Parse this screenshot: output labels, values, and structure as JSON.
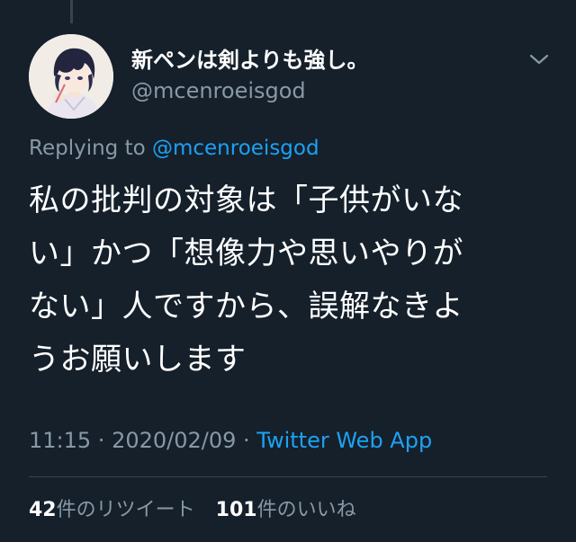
{
  "tweet": {
    "display_name": "新ペンは剣よりも強し。",
    "handle": "@mcenroeisgod",
    "replying_prefix": "Replying to ",
    "replying_to": "@mcenroeisgod",
    "text_lines": [
      "私の批判の対象は「子供がいな",
      "い」かつ「想像力や思いやりが",
      "ない」人ですから、誤解なきよ",
      "うお願いします"
    ],
    "time": "11:15",
    "separator": " · ",
    "date": "2020/02/09",
    "source": "Twitter Web App",
    "retweet_count": "42",
    "retweet_label": "件のリツイート",
    "like_count": "101",
    "like_label": "件のいいね"
  },
  "icons": {
    "menu": "chevron-down-icon",
    "avatar": "anime-avatar"
  },
  "colors": {
    "background": "#15202b",
    "primary_text": "#ffffff",
    "secondary_text": "#8899a6",
    "accent": "#1da1f2",
    "divider": "#38444d"
  }
}
